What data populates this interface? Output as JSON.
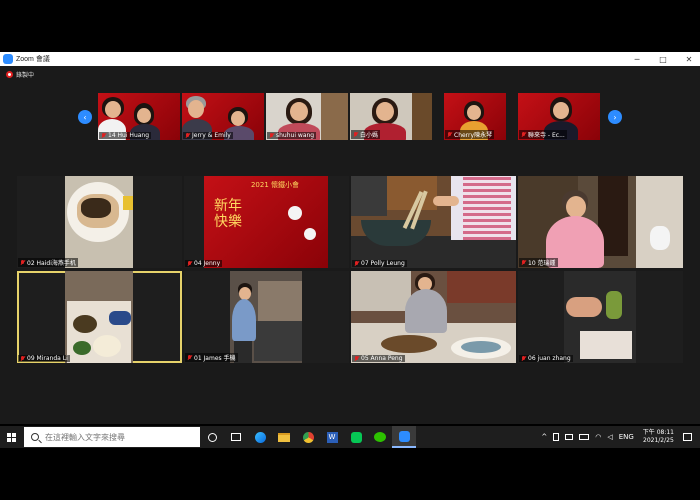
{
  "window": {
    "title": "Zoom 會議"
  },
  "window_controls": {
    "minimize": "─",
    "maximize": "□",
    "close": "✕"
  },
  "recording": {
    "label": "錄製中"
  },
  "thumbnails": [
    {
      "name": "14 Hui Huang"
    },
    {
      "name": "Jerry & Emily"
    },
    {
      "name": "shuhui wang"
    },
    {
      "name": "白小媽"
    },
    {
      "name": "Cherry陳永琴"
    },
    {
      "name": "聯來寺 - Ec..."
    }
  ],
  "tiles": [
    {
      "name": "02 Haidi海燕手机"
    },
    {
      "name": "04 Jenny"
    },
    {
      "name": "07 Polly Leung"
    },
    {
      "name": "10 范瑞鍾"
    },
    {
      "name": "09 Miranda Li"
    },
    {
      "name": "01 James 手機"
    },
    {
      "name": "05 Anna Peng"
    },
    {
      "name": "06 juan zhang"
    }
  ],
  "banner": {
    "line1": "2021 懷鐵小會",
    "line2": "新年快樂"
  },
  "taskbar": {
    "search_placeholder": "在這裡輸入文字來搜尋",
    "language": "ENG",
    "time": "下午 08:11",
    "date": "2021/2/25"
  },
  "colors": {
    "accent": "#2d8cff",
    "mute": "#e02020",
    "active_speaker": "#e6d26a"
  }
}
